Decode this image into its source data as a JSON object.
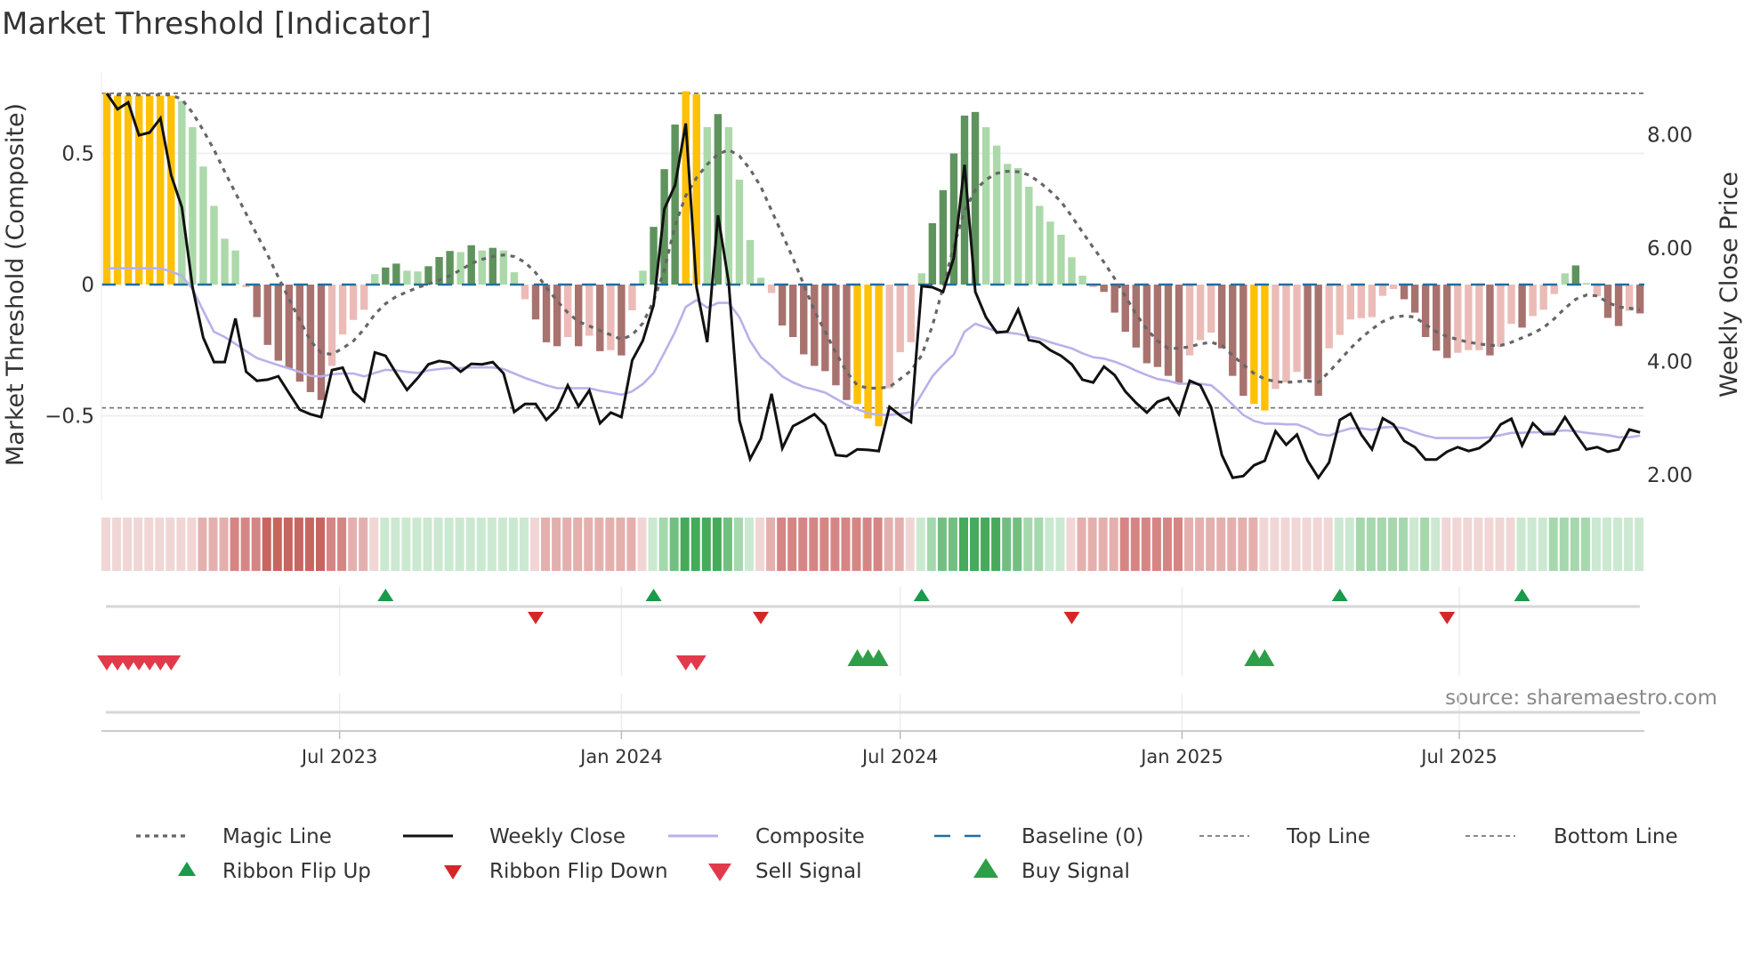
{
  "title": "Market Threshold [Indicator]",
  "source": "source: sharemaestro.com",
  "colors": {
    "yellow": "#FFC107",
    "light_green": "#acd9a9",
    "dark_green": "#5f935d",
    "dark_red": "#a8726f",
    "light_pink": "#ebbcb7",
    "close": "#111111",
    "composite": "#b9b1ea",
    "magic": "#666666",
    "baseline": "#1f6fa0",
    "thresholds": "#777777",
    "flip_up": "#1a9a4a",
    "flip_down": "#d62728",
    "sell": "#e23a4b",
    "buy": "#2e9e48",
    "ribbon_red": [
      "#f1d6d6",
      "#e4b0ae",
      "#d58684",
      "#c6665f"
    ],
    "ribbon_green": [
      "#cbe9d1",
      "#a6d8ae",
      "#72c081",
      "#46aa5a"
    ]
  },
  "chart_data": {
    "type": "bar+line",
    "title": "Market Threshold [Indicator]",
    "ylabel_left": "Market Threshold (Composite)",
    "ylabel_right": "Weekly Close Price",
    "ylim_left": [
      -0.8,
      0.82
    ],
    "ylim_right": [
      1.6,
      9.3
    ],
    "yticks_left": [
      {
        "v": 0.5,
        "label": "0.5"
      },
      {
        "v": 0,
        "label": "0"
      },
      {
        "v": -0.5,
        "label": "−0.5"
      }
    ],
    "yticks_right": [
      {
        "v": 8,
        "label": "8.00"
      },
      {
        "v": 6,
        "label": "6.00"
      },
      {
        "v": 4,
        "label": "4.00"
      },
      {
        "v": 2,
        "label": "2.00"
      }
    ],
    "x_start_date": "2023-01-30",
    "x_frequency": "weekly",
    "xticks": [
      {
        "date": "2023-07-01",
        "label": "Jul 2023"
      },
      {
        "date": "2024-01-01",
        "label": "Jan 2024"
      },
      {
        "date": "2024-07-01",
        "label": "Jul 2024"
      },
      {
        "date": "2025-01-01",
        "label": "Jan 2025"
      },
      {
        "date": "2025-07-01",
        "label": "Jul 2025"
      }
    ],
    "top_line": 0.729,
    "bottom_line": -0.47,
    "baseline": 0,
    "histogram": [
      0.73,
      0.72,
      0.72,
      0.72,
      0.72,
      0.72,
      0.72,
      0.7,
      0.6,
      0.45,
      0.3,
      0.175,
      0.13,
      -0.01,
      -0.124,
      -0.23,
      -0.29,
      -0.32,
      -0.37,
      -0.41,
      -0.44,
      -0.31,
      -0.19,
      -0.135,
      -0.096,
      0.04,
      0.065,
      0.08,
      0.053,
      0.05,
      0.07,
      0.105,
      0.128,
      0.124,
      0.15,
      0.13,
      0.14,
      0.13,
      0.047,
      -0.056,
      -0.133,
      -0.22,
      -0.235,
      -0.2,
      -0.235,
      -0.195,
      -0.254,
      -0.25,
      -0.27,
      -0.098,
      0.053,
      0.22,
      0.44,
      0.61,
      0.737,
      0.725,
      0.6,
      0.65,
      0.6,
      0.4,
      0.17,
      0.026,
      -0.032,
      -0.156,
      -0.2,
      -0.266,
      -0.31,
      -0.33,
      -0.384,
      -0.44,
      -0.455,
      -0.51,
      -0.54,
      -0.395,
      -0.258,
      -0.22,
      0.043,
      0.234,
      0.36,
      0.5,
      0.644,
      0.658,
      0.6,
      0.53,
      0.46,
      0.444,
      0.373,
      0.3,
      0.24,
      0.19,
      0.104,
      0.034,
      -0.01,
      -0.028,
      -0.107,
      -0.18,
      -0.24,
      -0.3,
      -0.314,
      -0.348,
      -0.375,
      -0.27,
      -0.212,
      -0.183,
      -0.243,
      -0.348,
      -0.424,
      -0.455,
      -0.48,
      -0.398,
      -0.373,
      -0.333,
      -0.36,
      -0.424,
      -0.243,
      -0.192,
      -0.133,
      -0.128,
      -0.124,
      -0.043,
      -0.017,
      -0.056,
      -0.107,
      -0.2,
      -0.252,
      -0.28,
      -0.26,
      -0.25,
      -0.25,
      -0.27,
      -0.237,
      -0.15,
      -0.164,
      -0.12,
      -0.096,
      -0.036,
      0.043,
      0.073,
      0.006,
      -0.045,
      -0.127,
      -0.158,
      -0.1,
      -0.11
    ],
    "histogram_color_codes": "yyyyyyyllllllpRRRRRRRppppldd lldddldldllpRRRpRpRpRplddd yyldllllpRRRRRRRyyyppplddddd llllllllllpRRRRRRRRpppRRRyypppRRpppppppRRRRRpppRppRpppldlpRRpR",
    "histogram_color_legend": {
      "y": "yellow",
      "l": "light_green",
      "d": "dark_green",
      "R": "dark_red",
      "p": "light_pink"
    },
    "weekly_close": [
      8.73,
      8.45,
      8.57,
      7.99,
      8.04,
      8.29,
      7.29,
      6.72,
      5.31,
      4.42,
      3.99,
      3.99,
      4.76,
      3.82,
      3.66,
      3.68,
      3.74,
      3.44,
      3.15,
      3.07,
      3.02,
      3.85,
      3.89,
      3.47,
      3.3,
      4.16,
      4.1,
      3.79,
      3.5,
      3.71,
      3.95,
      4.01,
      3.98,
      3.82,
      3.96,
      3.95,
      3.99,
      3.79,
      3.11,
      3.25,
      3.25,
      2.97,
      3.16,
      3.58,
      3.21,
      3.49,
      2.91,
      3.1,
      3.02,
      4.02,
      4.37,
      5.0,
      6.69,
      7.11,
      8.2,
      5.31,
      4.34,
      6.58,
      5.4,
      2.96,
      2.28,
      2.64,
      3.43,
      2.47,
      2.86,
      2.96,
      3.07,
      2.88,
      2.35,
      2.33,
      2.45,
      2.44,
      2.42,
      3.2,
      3.05,
      2.93,
      5.33,
      5.31,
      5.23,
      5.83,
      7.47,
      5.23,
      4.78,
      4.51,
      4.53,
      4.92,
      4.38,
      4.34,
      4.2,
      4.1,
      3.95,
      3.68,
      3.63,
      3.91,
      3.76,
      3.47,
      3.27,
      3.1,
      3.29,
      3.36,
      3.07,
      3.66,
      3.58,
      3.19,
      2.35,
      1.95,
      1.98,
      2.17,
      2.25,
      2.77,
      2.53,
      2.71,
      2.25,
      1.95,
      2.22,
      2.97,
      3.08,
      2.71,
      2.45,
      3.0,
      2.89,
      2.6,
      2.49,
      2.27,
      2.27,
      2.41,
      2.49,
      2.42,
      2.47,
      2.61,
      2.89,
      2.99,
      2.52,
      2.91,
      2.72,
      2.72,
      3.02,
      2.72,
      2.45,
      2.49,
      2.41,
      2.45,
      2.8,
      2.75
    ],
    "composite": [
      0.062,
      0.062,
      0.062,
      0.062,
      0.062,
      0.062,
      0.05,
      0.034,
      -0.017,
      -0.1,
      -0.18,
      -0.2,
      -0.226,
      -0.254,
      -0.28,
      -0.294,
      -0.307,
      -0.32,
      -0.333,
      -0.348,
      -0.35,
      -0.342,
      -0.339,
      -0.339,
      -0.35,
      -0.337,
      -0.325,
      -0.327,
      -0.333,
      -0.337,
      -0.327,
      -0.322,
      -0.318,
      -0.318,
      -0.316,
      -0.316,
      -0.316,
      -0.322,
      -0.339,
      -0.356,
      -0.37,
      -0.384,
      -0.395,
      -0.395,
      -0.395,
      -0.395,
      -0.405,
      -0.412,
      -0.42,
      -0.407,
      -0.379,
      -0.337,
      -0.26,
      -0.18,
      -0.085,
      -0.059,
      -0.088,
      -0.07,
      -0.07,
      -0.124,
      -0.215,
      -0.277,
      -0.31,
      -0.35,
      -0.373,
      -0.39,
      -0.4,
      -0.412,
      -0.435,
      -0.458,
      -0.475,
      -0.49,
      -0.497,
      -0.497,
      -0.493,
      -0.486,
      -0.418,
      -0.35,
      -0.305,
      -0.266,
      -0.18,
      -0.149,
      -0.164,
      -0.178,
      -0.183,
      -0.188,
      -0.198,
      -0.206,
      -0.22,
      -0.232,
      -0.243,
      -0.262,
      -0.277,
      -0.282,
      -0.294,
      -0.31,
      -0.328,
      -0.345,
      -0.36,
      -0.367,
      -0.378,
      -0.378,
      -0.378,
      -0.384,
      -0.418,
      -0.458,
      -0.497,
      -0.52,
      -0.53,
      -0.53,
      -0.533,
      -0.533,
      -0.548,
      -0.57,
      -0.576,
      -0.56,
      -0.548,
      -0.548,
      -0.554,
      -0.545,
      -0.542,
      -0.548,
      -0.563,
      -0.576,
      -0.585,
      -0.585,
      -0.585,
      -0.585,
      -0.585,
      -0.582,
      -0.574,
      -0.565,
      -0.565,
      -0.563,
      -0.563,
      -0.559,
      -0.556,
      -0.559,
      -0.565,
      -0.57,
      -0.574,
      -0.582,
      -0.582,
      -0.576
    ],
    "magic_line": [
      0.723,
      0.723,
      0.723,
      0.723,
      0.723,
      0.723,
      0.723,
      0.706,
      0.655,
      0.588,
      0.514,
      0.43,
      0.35,
      0.27,
      0.19,
      0.113,
      0.028,
      -0.056,
      -0.136,
      -0.215,
      -0.26,
      -0.266,
      -0.243,
      -0.215,
      -0.17,
      -0.113,
      -0.073,
      -0.045,
      -0.028,
      -0.011,
      0.002,
      0.017,
      0.034,
      0.056,
      0.08,
      0.096,
      0.107,
      0.113,
      0.107,
      0.085,
      0.045,
      -0.011,
      -0.062,
      -0.107,
      -0.141,
      -0.158,
      -0.175,
      -0.192,
      -0.209,
      -0.192,
      -0.147,
      -0.062,
      0.056,
      0.226,
      0.339,
      0.407,
      0.458,
      0.497,
      0.514,
      0.49,
      0.44,
      0.373,
      0.282,
      0.192,
      0.1,
      0.0,
      -0.1,
      -0.18,
      -0.26,
      -0.333,
      -0.384,
      -0.395,
      -0.395,
      -0.39,
      -0.36,
      -0.328,
      -0.27,
      -0.158,
      -0.011,
      0.147,
      0.282,
      0.36,
      0.4,
      0.424,
      0.432,
      0.43,
      0.418,
      0.39,
      0.356,
      0.316,
      0.26,
      0.2,
      0.141,
      0.085,
      0.023,
      -0.045,
      -0.113,
      -0.17,
      -0.215,
      -0.243,
      -0.243,
      -0.237,
      -0.226,
      -0.22,
      -0.232,
      -0.27,
      -0.305,
      -0.339,
      -0.36,
      -0.37,
      -0.373,
      -0.37,
      -0.367,
      -0.373,
      -0.333,
      -0.288,
      -0.243,
      -0.203,
      -0.17,
      -0.141,
      -0.124,
      -0.119,
      -0.124,
      -0.153,
      -0.18,
      -0.198,
      -0.209,
      -0.22,
      -0.226,
      -0.232,
      -0.232,
      -0.22,
      -0.203,
      -0.186,
      -0.164,
      -0.13,
      -0.09,
      -0.056,
      -0.04,
      -0.043,
      -0.068,
      -0.085,
      -0.09,
      -0.096
    ],
    "ribbon": [
      -1,
      -1,
      -1,
      -1,
      -1,
      -1,
      -1,
      -1,
      -1,
      -2,
      -2,
      -2,
      -3,
      -3,
      -3,
      -4,
      -4,
      -4,
      -4,
      -4,
      -4,
      -3,
      -3,
      -2,
      -2,
      -1,
      1,
      1,
      1,
      1,
      1,
      1,
      1,
      1,
      1,
      1,
      1,
      1,
      1,
      1,
      -1,
      -2,
      -2,
      -2,
      -2,
      -2,
      -2,
      -2,
      -2,
      -2,
      -1,
      1,
      2,
      3,
      4,
      4,
      4,
      4,
      3,
      2,
      1,
      -1,
      -2,
      -3,
      -3,
      -3,
      -3,
      -3,
      -3,
      -3,
      -3,
      -3,
      -3,
      -2,
      -2,
      -1,
      1,
      2,
      3,
      3,
      4,
      4,
      4,
      4,
      3,
      3,
      2,
      2,
      1,
      1,
      -1,
      -2,
      -2,
      -2,
      -2,
      -3,
      -3,
      -3,
      -3,
      -3,
      -3,
      -2,
      -2,
      -2,
      -2,
      -2,
      -2,
      -2,
      -1,
      -1,
      -1,
      -1,
      -1,
      -1,
      -1,
      1,
      1,
      2,
      2,
      2,
      2,
      2,
      1,
      2,
      1,
      -1,
      -1,
      -1,
      -1,
      -1,
      -1,
      -1,
      1,
      1,
      1,
      2,
      2,
      2,
      2,
      1,
      1,
      1,
      1,
      1
    ],
    "ribbon_flip_up_weeks": [
      26,
      51,
      76,
      115,
      132
    ],
    "ribbon_flip_down_weeks": [
      40,
      61,
      90,
      125
    ],
    "sell_signal_weeks": [
      0,
      1,
      2,
      3,
      4,
      5,
      6,
      54,
      55
    ],
    "buy_signal_weeks": [
      70,
      71,
      72,
      107,
      108
    ],
    "legend": [
      {
        "key": "magic",
        "label": "Magic Line"
      },
      {
        "key": "close",
        "label": "Weekly Close"
      },
      {
        "key": "composite",
        "label": "Composite"
      },
      {
        "key": "baseline",
        "label": "Baseline (0)"
      },
      {
        "key": "top",
        "label": "Top Line"
      },
      {
        "key": "bottom",
        "label": "Bottom Line"
      },
      {
        "key": "flip_up",
        "label": "Ribbon Flip Up"
      },
      {
        "key": "flip_down",
        "label": "Ribbon Flip Down"
      },
      {
        "key": "sell",
        "label": "Sell Signal"
      },
      {
        "key": "buy",
        "label": "Buy Signal"
      }
    ],
    "legend_placement": "bottom"
  }
}
